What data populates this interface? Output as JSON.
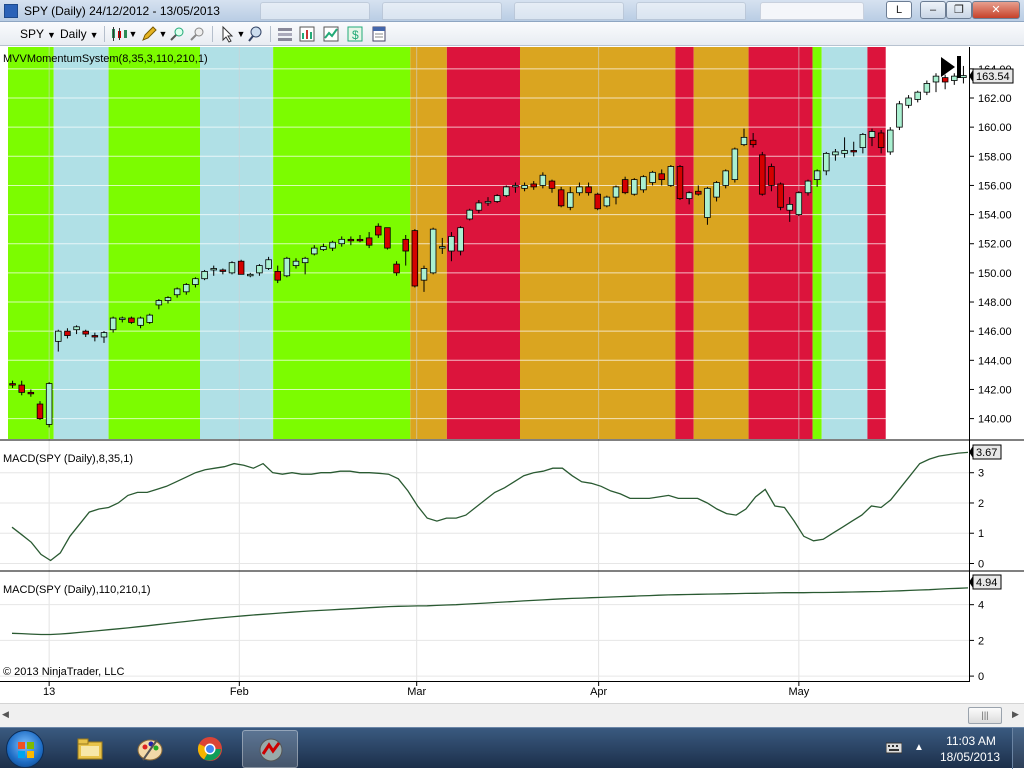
{
  "window": {
    "title": "SPY (Daily)  24/12/2012 - 13/05/2013",
    "letter_button": "L",
    "minimize_glyph": "–",
    "maximize_glyph": "❐",
    "close_glyph": "✕"
  },
  "toolbar": {
    "instrument": "SPY",
    "interval": "Daily",
    "icons": [
      "candlestick-style-icon",
      "draw-pencil-icon",
      "zoom-in-icon",
      "zoom-out-icon",
      "cursor-pointer-icon",
      "magnifier-icon",
      "properties-icon",
      "strategies-icon",
      "chart-data-icon",
      "dollar-icon",
      "data-box-icon"
    ]
  },
  "colors": {
    "green": "#7cfc00",
    "lightblue": "#b0e0e6",
    "gold": "#daa520",
    "crimson": "#dc143c",
    "up_candle": "#aaf0d1",
    "down_candle": "#d40000",
    "macd_line": "#2a5a32",
    "axis_text": "#000000"
  },
  "chart_data": [
    {
      "type": "candlestick",
      "panel": "price",
      "indicator_label": "MVVMomentumSystem(8,35,3,110,210,1)",
      "last_value": "163.54",
      "y_ticks": [
        "140.00",
        "142.00",
        "144.00",
        "146.00",
        "148.00",
        "150.00",
        "152.00",
        "154.00",
        "156.00",
        "158.00",
        "160.00",
        "162.00",
        "164.00"
      ],
      "ylim": [
        138.6,
        165.5
      ],
      "background_regions": [
        {
          "from": 0,
          "to": 4,
          "color": "green"
        },
        {
          "from": 5,
          "to": 10,
          "color": "lightblue"
        },
        {
          "from": 11,
          "to": 20,
          "color": "green"
        },
        {
          "from": 21,
          "to": 28,
          "color": "lightblue"
        },
        {
          "from": 29,
          "to": 43,
          "color": "green"
        },
        {
          "from": 44,
          "to": 47,
          "color": "gold"
        },
        {
          "from": 48,
          "to": 55,
          "color": "crimson"
        },
        {
          "from": 56,
          "to": 72,
          "color": "gold"
        },
        {
          "from": 73,
          "to": 74,
          "color": "crimson"
        },
        {
          "from": 75,
          "to": 80,
          "color": "gold"
        },
        {
          "from": 81,
          "to": 87,
          "color": "crimson"
        },
        {
          "from": 88,
          "to": 88,
          "color": "green"
        },
        {
          "from": 89,
          "to": 93,
          "color": "lightblue"
        },
        {
          "from": 94,
          "to": 95,
          "color": "crimson"
        }
      ],
      "candles": [
        [
          142.4,
          142.6,
          142.1,
          142.3
        ],
        [
          142.3,
          142.6,
          141.6,
          141.8
        ],
        [
          141.8,
          142.0,
          141.5,
          141.7
        ],
        [
          141.0,
          141.2,
          139.9,
          140.0
        ],
        [
          139.6,
          142.5,
          139.4,
          142.4
        ],
        [
          145.3,
          146.1,
          144.6,
          146.0
        ],
        [
          146.0,
          146.2,
          145.5,
          145.7
        ],
        [
          146.1,
          146.4,
          145.8,
          146.3
        ],
        [
          146.0,
          146.1,
          145.6,
          145.8
        ],
        [
          145.7,
          145.9,
          145.3,
          145.6
        ],
        [
          145.6,
          146.0,
          145.2,
          145.9
        ],
        [
          146.1,
          147.0,
          145.9,
          146.9
        ],
        [
          146.8,
          147.0,
          146.6,
          146.9
        ],
        [
          146.9,
          147.0,
          146.5,
          146.6
        ],
        [
          146.4,
          147.0,
          146.2,
          146.9
        ],
        [
          146.6,
          147.2,
          146.5,
          147.1
        ],
        [
          147.8,
          148.2,
          147.5,
          148.1
        ],
        [
          148.1,
          148.4,
          147.9,
          148.3
        ],
        [
          148.5,
          149.0,
          148.3,
          148.9
        ],
        [
          148.7,
          149.3,
          148.5,
          149.2
        ],
        [
          149.2,
          149.7,
          149.0,
          149.6
        ],
        [
          149.6,
          150.2,
          149.5,
          150.1
        ],
        [
          150.2,
          150.5,
          149.8,
          150.3
        ],
        [
          150.2,
          150.3,
          149.9,
          150.1
        ],
        [
          150.0,
          150.8,
          149.9,
          150.7
        ],
        [
          150.8,
          150.9,
          149.9,
          149.9
        ],
        [
          149.8,
          150.0,
          149.7,
          149.9
        ],
        [
          150.0,
          150.6,
          149.8,
          150.5
        ],
        [
          150.3,
          151.1,
          150.2,
          150.9
        ],
        [
          150.1,
          150.5,
          149.3,
          149.5
        ],
        [
          149.8,
          151.1,
          149.7,
          151.0
        ],
        [
          150.5,
          151.0,
          150.3,
          150.8
        ],
        [
          150.7,
          151.1,
          149.9,
          151.0
        ],
        [
          151.3,
          151.9,
          151.2,
          151.7
        ],
        [
          151.6,
          152.0,
          151.5,
          151.8
        ],
        [
          151.7,
          152.2,
          151.5,
          152.1
        ],
        [
          152.0,
          152.5,
          151.8,
          152.3
        ],
        [
          152.3,
          152.5,
          151.9,
          152.2
        ],
        [
          152.3,
          152.6,
          152.1,
          152.2
        ],
        [
          152.4,
          152.8,
          151.7,
          151.9
        ],
        [
          153.2,
          153.4,
          152.4,
          152.6
        ],
        [
          153.1,
          153.1,
          151.6,
          151.7
        ],
        [
          150.6,
          150.8,
          149.8,
          150.0
        ],
        [
          152.3,
          152.6,
          150.5,
          151.5
        ],
        [
          152.9,
          153.0,
          149.0,
          149.1
        ],
        [
          149.5,
          150.5,
          148.7,
          150.3
        ],
        [
          150.0,
          153.1,
          149.9,
          153.0
        ],
        [
          151.7,
          152.4,
          151.3,
          151.8
        ],
        [
          151.5,
          152.8,
          150.8,
          152.5
        ],
        [
          151.5,
          153.2,
          151.2,
          153.1
        ],
        [
          153.7,
          154.4,
          153.6,
          154.3
        ],
        [
          154.3,
          155.0,
          154.1,
          154.8
        ],
        [
          154.8,
          155.2,
          154.6,
          154.9
        ],
        [
          154.9,
          155.4,
          154.8,
          155.3
        ],
        [
          155.3,
          156.0,
          155.2,
          155.9
        ],
        [
          155.9,
          156.2,
          155.5,
          156.0
        ],
        [
          155.8,
          156.2,
          155.6,
          156.0
        ],
        [
          156.1,
          156.3,
          155.7,
          155.9
        ],
        [
          156.0,
          156.9,
          155.8,
          156.7
        ],
        [
          156.3,
          156.4,
          155.5,
          155.8
        ],
        [
          155.7,
          155.9,
          154.5,
          154.6
        ],
        [
          154.5,
          155.9,
          154.3,
          155.5
        ],
        [
          155.5,
          156.2,
          155.3,
          155.9
        ],
        [
          155.9,
          156.2,
          155.3,
          155.5
        ],
        [
          155.4,
          155.5,
          154.3,
          154.4
        ],
        [
          154.6,
          155.3,
          154.5,
          155.2
        ],
        [
          155.2,
          156.0,
          154.7,
          155.9
        ],
        [
          156.4,
          156.6,
          155.4,
          155.5
        ],
        [
          155.4,
          156.5,
          155.3,
          156.4
        ],
        [
          155.7,
          156.7,
          155.5,
          156.6
        ],
        [
          156.2,
          157.0,
          156.0,
          156.9
        ],
        [
          156.8,
          157.1,
          156.0,
          156.4
        ],
        [
          156.0,
          157.4,
          155.9,
          157.3
        ],
        [
          157.3,
          157.4,
          155.0,
          155.1
        ],
        [
          155.1,
          155.6,
          154.7,
          155.5
        ],
        [
          155.6,
          156.0,
          155.3,
          155.4
        ],
        [
          153.8,
          155.9,
          153.3,
          155.8
        ],
        [
          155.2,
          156.3,
          154.9,
          156.2
        ],
        [
          156.0,
          157.1,
          155.8,
          157.0
        ],
        [
          156.4,
          158.6,
          156.2,
          158.5
        ],
        [
          158.8,
          159.9,
          158.7,
          159.3
        ],
        [
          159.1,
          159.6,
          158.6,
          158.8
        ],
        [
          158.1,
          158.3,
          155.3,
          155.4
        ],
        [
          157.3,
          157.5,
          155.6,
          156.0
        ],
        [
          156.1,
          156.2,
          154.3,
          154.5
        ],
        [
          154.3,
          155.2,
          153.5,
          154.7
        ],
        [
          154.0,
          155.6,
          153.9,
          155.5
        ],
        [
          155.5,
          156.4,
          155.3,
          156.3
        ],
        [
          156.4,
          157.1,
          155.9,
          157.0
        ],
        [
          157.0,
          158.3,
          156.7,
          158.2
        ],
        [
          158.1,
          158.5,
          157.7,
          158.3
        ],
        [
          158.2,
          159.3,
          157.9,
          158.4
        ],
        [
          158.4,
          159.0,
          158.0,
          158.3
        ],
        [
          158.6,
          159.6,
          158.2,
          159.5
        ],
        [
          159.3,
          159.9,
          158.7,
          159.7
        ],
        [
          159.6,
          159.8,
          158.2,
          158.6
        ],
        [
          158.3,
          160.0,
          158.1,
          159.8
        ],
        [
          160.0,
          161.8,
          159.8,
          161.6
        ],
        [
          161.5,
          162.2,
          161.3,
          162.0
        ],
        [
          161.9,
          162.5,
          161.7,
          162.4
        ],
        [
          162.4,
          163.2,
          162.2,
          163.0
        ],
        [
          163.1,
          163.7,
          162.4,
          163.5
        ],
        [
          163.4,
          163.6,
          162.6,
          163.1
        ],
        [
          163.2,
          163.7,
          162.9,
          163.5
        ],
        [
          163.4,
          164.2,
          163.0,
          163.54
        ]
      ],
      "x_labels": [
        {
          "label": "13",
          "index": 4.5
        },
        {
          "label": "Feb",
          "index": 25.3
        },
        {
          "label": "Mar",
          "index": 44.7
        },
        {
          "label": "Apr",
          "index": 64.6
        },
        {
          "label": "May",
          "index": 86.5
        }
      ]
    },
    {
      "type": "line",
      "panel": "macd_fast",
      "indicator_label": "MACD(SPY (Daily),8,35,1)",
      "last_value": "3.67",
      "y_ticks": [
        "0",
        "1",
        "2",
        "3"
      ],
      "ylim": [
        -0.05,
        3.85
      ],
      "values": [
        1.2,
        0.95,
        0.7,
        0.3,
        0.1,
        0.35,
        0.9,
        1.3,
        1.7,
        1.8,
        1.85,
        2.0,
        2.25,
        2.35,
        2.35,
        2.45,
        2.55,
        2.7,
        2.85,
        3.0,
        3.1,
        3.15,
        3.2,
        3.3,
        3.25,
        3.15,
        3.3,
        3.0,
        2.95,
        3.0,
        2.95,
        2.95,
        3.0,
        3.0,
        3.05,
        3.05,
        3.0,
        3.0,
        2.98,
        2.95,
        2.8,
        2.4,
        1.9,
        1.5,
        1.4,
        1.5,
        1.5,
        1.6,
        1.85,
        2.1,
        2.35,
        2.5,
        2.7,
        2.9,
        3.0,
        3.05,
        3.15,
        3.15,
        2.9,
        2.7,
        2.65,
        2.55,
        2.4,
        2.3,
        2.15,
        2.15,
        2.15,
        2.2,
        2.25,
        2.15,
        2.15,
        2.15,
        2.0,
        1.8,
        1.65,
        1.6,
        1.8,
        2.2,
        2.45,
        1.9,
        1.85,
        1.4,
        0.9,
        0.75,
        0.8,
        1.0,
        1.2,
        1.4,
        1.6,
        1.9,
        1.85,
        2.1,
        2.5,
        2.9,
        3.3,
        3.45,
        3.55,
        3.6,
        3.65,
        3.67
      ]
    },
    {
      "type": "line",
      "panel": "macd_slow",
      "indicator_label": "MACD(SPY (Daily),110,210,1)",
      "last_value": "4.94",
      "y_ticks": [
        "0",
        "2",
        "4"
      ],
      "ylim": [
        -0.05,
        5.55
      ],
      "values": [
        2.4,
        2.38,
        2.35,
        2.33,
        2.33,
        2.36,
        2.4,
        2.45,
        2.5,
        2.55,
        2.6,
        2.65,
        2.7,
        2.76,
        2.82,
        2.88,
        2.94,
        3.0,
        3.06,
        3.12,
        3.18,
        3.23,
        3.28,
        3.33,
        3.38,
        3.42,
        3.46,
        3.5,
        3.54,
        3.58,
        3.62,
        3.65,
        3.68,
        3.71,
        3.74,
        3.77,
        3.8,
        3.83,
        3.86,
        3.89,
        3.91,
        3.92,
        3.93,
        3.94,
        3.96,
        3.98,
        4.0,
        4.03,
        4.06,
        4.09,
        4.12,
        4.15,
        4.18,
        4.21,
        4.24,
        4.27,
        4.3,
        4.33,
        4.35,
        4.37,
        4.39,
        4.41,
        4.43,
        4.45,
        4.47,
        4.49,
        4.51,
        4.53,
        4.55,
        4.56,
        4.57,
        4.58,
        4.59,
        4.6,
        4.61,
        4.62,
        4.63,
        4.64,
        4.65,
        4.66,
        4.67,
        4.67,
        4.67,
        4.68,
        4.68,
        4.69,
        4.7,
        4.71,
        4.72,
        4.73,
        4.74,
        4.76,
        4.78,
        4.8,
        4.82,
        4.84,
        4.87,
        4.9,
        4.92,
        4.94
      ]
    }
  ],
  "footer": {
    "copyright": "© 2013 NinjaTrader, LLC"
  },
  "taskbar": {
    "apps": [
      "folder-explorer-icon",
      "paint-icon",
      "chrome-icon",
      "ninjatrader-icon"
    ],
    "time": "11:03 AM",
    "date": "18/05/2013"
  }
}
